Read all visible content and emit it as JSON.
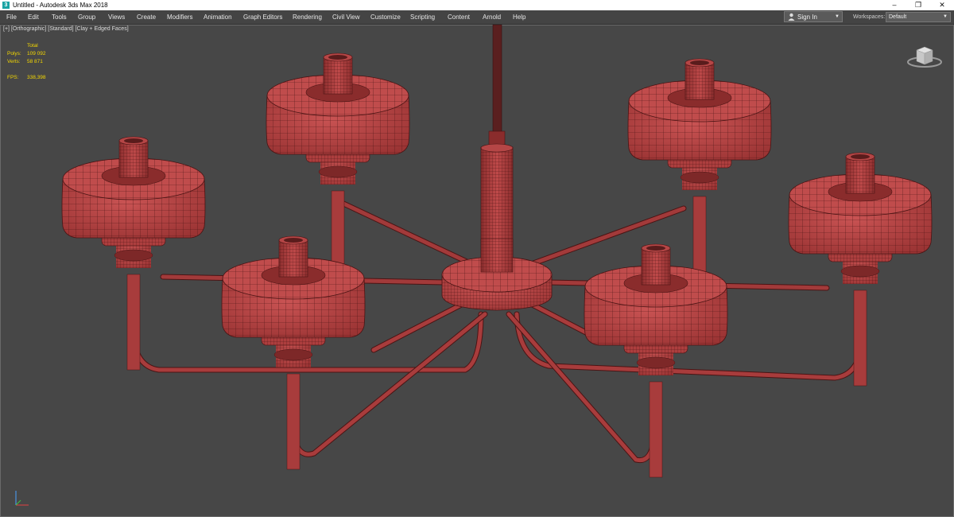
{
  "window": {
    "title": "Untitled - Autodesk 3ds Max 2018",
    "icon_letter": "3",
    "icon": "app-logo-icon",
    "controls": {
      "minimize": "–",
      "restore": "❐",
      "close": "✕"
    }
  },
  "menu": {
    "items": [
      "File",
      "Edit",
      "Tools",
      "Group",
      "Views",
      "Create",
      "Modifiers",
      "Animation",
      "Graph Editors",
      "Rendering",
      "Civil View",
      "Customize",
      "Scripting",
      "Content",
      "Arnold",
      "Help"
    ]
  },
  "account": {
    "sign_in": "Sign In",
    "icon": "user-icon"
  },
  "workspaces": {
    "label": "Workspaces:",
    "value": "Default"
  },
  "viewport": {
    "labels": [
      "[+]",
      "[Orthographic]",
      "[Standard]",
      "[Clay + Edged Faces]"
    ],
    "stats": {
      "header": "Total",
      "polys_label": "Polys:",
      "polys_value": "109 092",
      "verts_label": "Verts:",
      "verts_value": "58 871",
      "fps_label": "FPS:",
      "fps_value": "338,398"
    },
    "colors": {
      "mesh": "#b94444",
      "wire": "#4a1414",
      "background": "#474747",
      "stats": "#f5d800"
    }
  }
}
